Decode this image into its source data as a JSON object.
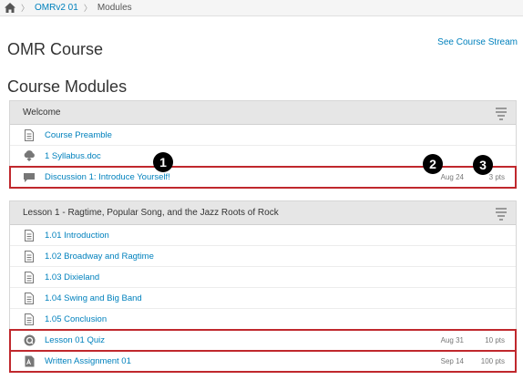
{
  "breadcrumb": {
    "course": "OMRv2 01",
    "page": "Modules"
  },
  "course": {
    "title": "OMR Course",
    "stream_link": "See Course Stream"
  },
  "modules_title": "Course Modules",
  "modules": [
    {
      "name": "Welcome",
      "items": [
        {
          "title": "Course Preamble",
          "icon": "page-icon",
          "date": "",
          "pts": ""
        },
        {
          "title": "1 Syllabus.doc",
          "icon": "download-icon",
          "date": "",
          "pts": ""
        },
        {
          "title": "Discussion 1: Introduce Yourself!",
          "icon": "discussion-icon",
          "date": "Aug 24",
          "pts": "3 pts"
        }
      ]
    },
    {
      "name": "Lesson 1 - Ragtime, Popular Song, and the Jazz Roots of Rock",
      "items": [
        {
          "title": "1.01 Introduction",
          "icon": "page-icon",
          "date": "",
          "pts": ""
        },
        {
          "title": "1.02 Broadway and Ragtime",
          "icon": "page-icon",
          "date": "",
          "pts": ""
        },
        {
          "title": "1.03 Dixieland",
          "icon": "page-icon",
          "date": "",
          "pts": ""
        },
        {
          "title": "1.04 Swing and Big Band",
          "icon": "page-icon",
          "date": "",
          "pts": ""
        },
        {
          "title": "1.05 Conclusion",
          "icon": "page-icon",
          "date": "",
          "pts": ""
        },
        {
          "title": "Lesson 01 Quiz",
          "icon": "quiz-icon",
          "date": "Aug 31",
          "pts": "10 pts"
        },
        {
          "title": "Written Assignment 01",
          "icon": "assignment-icon",
          "date": "Sep 14",
          "pts": "100 pts"
        }
      ]
    }
  ],
  "callouts": [
    "1",
    "2",
    "3"
  ],
  "colors": {
    "link": "#0081bd",
    "highlight": "#c0282d",
    "header_bg": "#e6e6e6"
  }
}
